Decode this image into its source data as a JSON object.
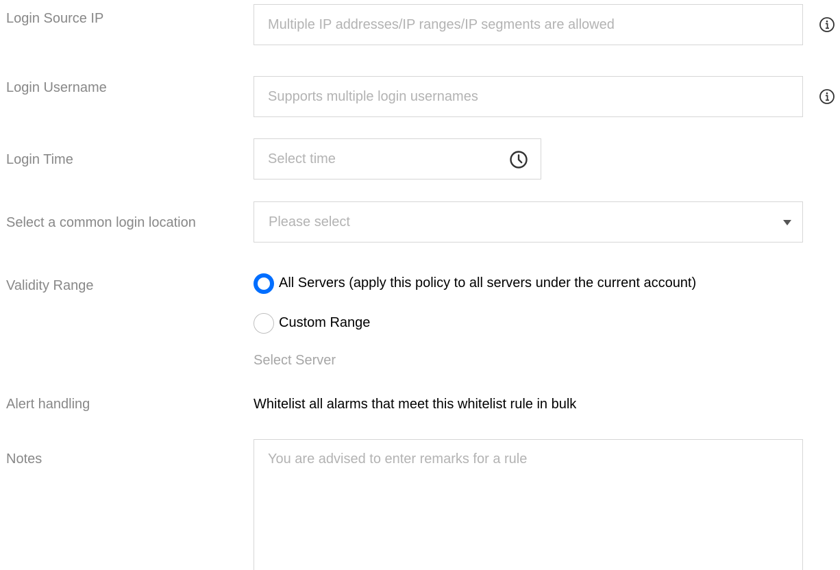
{
  "form": {
    "login_source_ip": {
      "label": "Login Source IP",
      "placeholder": "Multiple IP addresses/IP ranges/IP segments are allowed",
      "value": "",
      "help_icon": "info-circle-icon"
    },
    "login_username": {
      "label": "Login Username",
      "placeholder": "Supports multiple login usernames",
      "value": "",
      "help_icon": "info-circle-icon"
    },
    "login_time": {
      "label": "Login Time",
      "placeholder": "Select time",
      "value": "",
      "icon": "clock-icon"
    },
    "common_location": {
      "label": "Select a common login location",
      "selected": "Please select",
      "icon": "caret-down-icon"
    },
    "validity_range": {
      "label": "Validity Range",
      "options": [
        {
          "label": "All Servers (apply this policy to all servers under the current account)",
          "checked": true
        },
        {
          "label": "Custom Range",
          "checked": false
        }
      ],
      "select_server_text": "Select Server"
    },
    "alert_handling": {
      "label": "Alert handling",
      "text": "Whitelist all alarms that meet this whitelist rule in bulk"
    },
    "notes": {
      "label": "Notes",
      "placeholder": "You are advised to enter remarks for a rule",
      "value": ""
    }
  },
  "colors": {
    "label": "#888888",
    "placeholder": "#b3b3b3",
    "border": "#d6d6d6",
    "accent": "#006eff",
    "text": "#000000"
  }
}
